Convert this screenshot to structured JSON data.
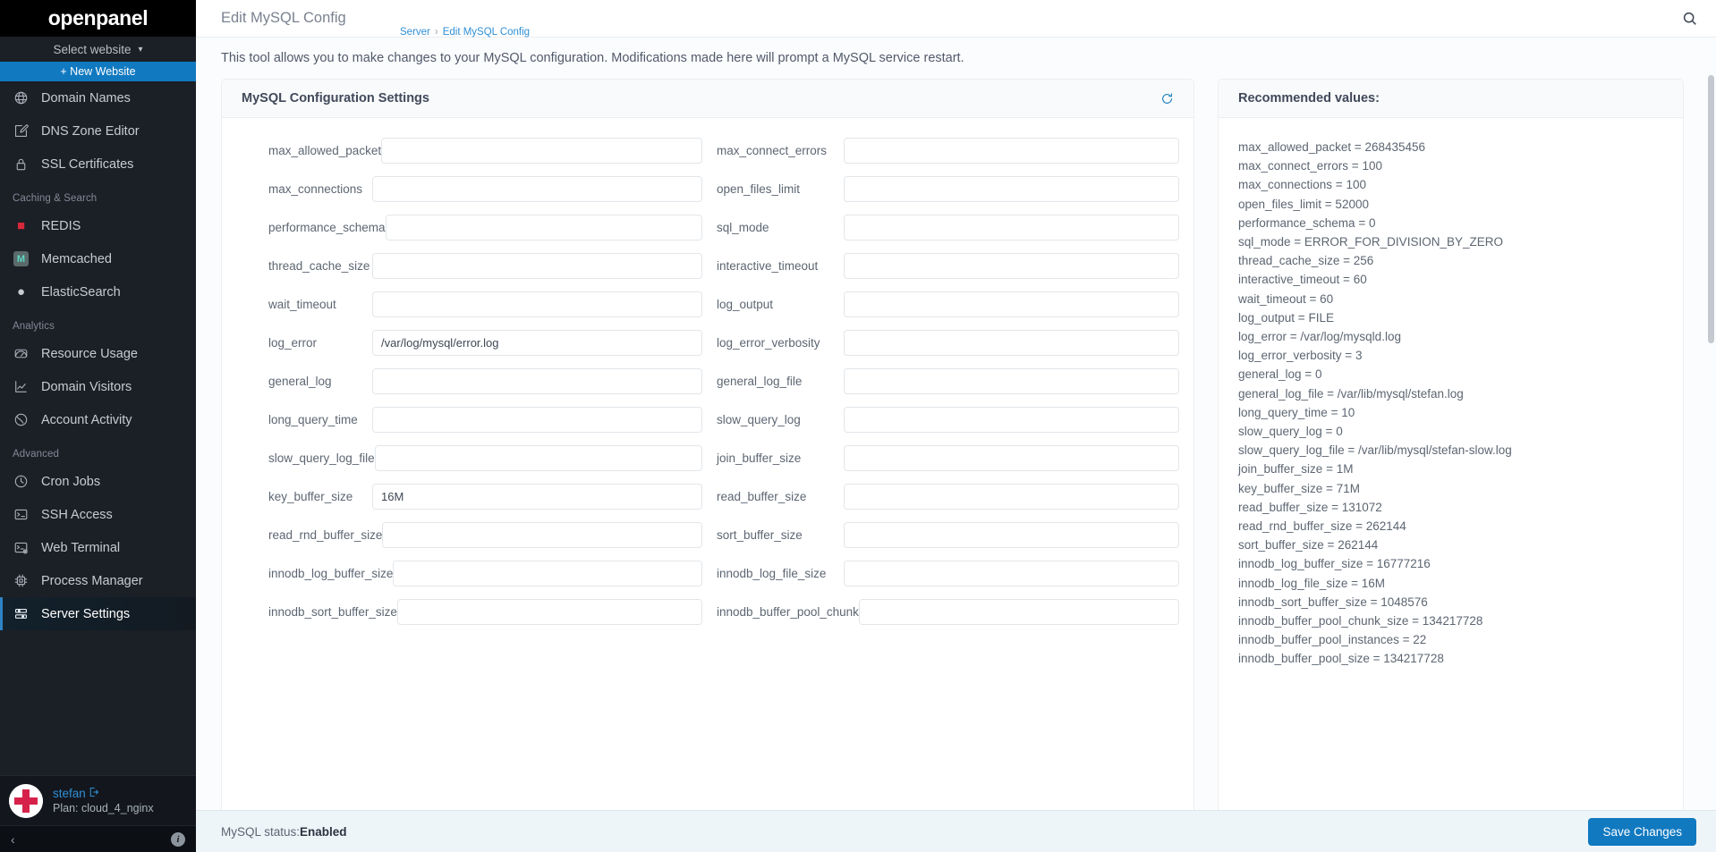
{
  "brand": {
    "name": "openpanel"
  },
  "sidebar": {
    "site_select": {
      "label": "Select website",
      "icon": "chevron-down-icon"
    },
    "new_website": {
      "label": "+ New Website"
    },
    "groups": [
      {
        "title": null,
        "items": [
          {
            "label": "Domain Names",
            "icon": "globe-icon",
            "active": false
          },
          {
            "label": "DNS Zone Editor",
            "icon": "edit-square-icon",
            "active": false
          },
          {
            "label": "SSL Certificates",
            "icon": "lock-icon",
            "active": false
          }
        ]
      },
      {
        "title": "Caching & Search",
        "items": [
          {
            "label": "REDIS",
            "icon": "redis-logo-icon",
            "active": false
          },
          {
            "label": "Memcached",
            "icon": "memcached-logo-icon",
            "active": false
          },
          {
            "label": "ElasticSearch",
            "icon": "elasticsearch-logo-icon",
            "active": false
          }
        ]
      },
      {
        "title": "Analytics",
        "items": [
          {
            "label": "Resource Usage",
            "icon": "gauge-icon",
            "active": false
          },
          {
            "label": "Domain Visitors",
            "icon": "line-chart-icon",
            "active": false
          },
          {
            "label": "Account Activity",
            "icon": "globe-activity-icon",
            "active": false
          }
        ]
      },
      {
        "title": "Advanced",
        "items": [
          {
            "label": "Cron Jobs",
            "icon": "clock-icon",
            "active": false
          },
          {
            "label": "SSH Access",
            "icon": "terminal-icon",
            "active": false
          },
          {
            "label": "Web Terminal",
            "icon": "web-terminal-icon",
            "active": false
          },
          {
            "label": "Process Manager",
            "icon": "cpu-icon",
            "active": false
          },
          {
            "label": "Server Settings",
            "icon": "server-settings-icon",
            "active": true
          }
        ]
      }
    ],
    "user": {
      "name": "stefan",
      "logout_icon": "logout-icon",
      "plan": "Plan: cloud_4_nginx",
      "avatar": "red-cross-avatar"
    },
    "footer": {
      "collapse_icon": "chevron-left-icon",
      "info_icon": "info-icon"
    }
  },
  "header": {
    "title": "Edit MySQL Config",
    "search_icon": "search-icon",
    "breadcrumb": [
      "Server",
      "Edit MySQL Config"
    ],
    "breadcrumb_separator": "›"
  },
  "intro": "This tool allows you to make changes to your MySQL configuration. Modifications made here will prompt a MySQL service restart.",
  "config_panel": {
    "title": "MySQL Configuration Settings",
    "refresh_icon": "refresh-icon",
    "rows": [
      {
        "left": {
          "label": "max_allowed_packet",
          "value": ""
        },
        "right": {
          "label": "max_connect_errors",
          "value": ""
        }
      },
      {
        "left": {
          "label": "max_connections",
          "value": ""
        },
        "right": {
          "label": "open_files_limit",
          "value": ""
        }
      },
      {
        "left": {
          "label": "performance_schema",
          "value": ""
        },
        "right": {
          "label": "sql_mode",
          "value": ""
        }
      },
      {
        "left": {
          "label": "thread_cache_size",
          "value": ""
        },
        "right": {
          "label": "interactive_timeout",
          "value": ""
        }
      },
      {
        "left": {
          "label": "wait_timeout",
          "value": ""
        },
        "right": {
          "label": "log_output",
          "value": ""
        }
      },
      {
        "left": {
          "label": "log_error",
          "value": "/var/log/mysql/error.log"
        },
        "right": {
          "label": "log_error_verbosity",
          "value": ""
        }
      },
      {
        "left": {
          "label": "general_log",
          "value": ""
        },
        "right": {
          "label": "general_log_file",
          "value": ""
        }
      },
      {
        "left": {
          "label": "long_query_time",
          "value": ""
        },
        "right": {
          "label": "slow_query_log",
          "value": ""
        }
      },
      {
        "left": {
          "label": "slow_query_log_file",
          "value": ""
        },
        "right": {
          "label": "join_buffer_size",
          "value": ""
        }
      },
      {
        "left": {
          "label": "key_buffer_size",
          "value": "16M"
        },
        "right": {
          "label": "read_buffer_size",
          "value": ""
        }
      },
      {
        "left": {
          "label": "read_rnd_buffer_size",
          "value": ""
        },
        "right": {
          "label": "sort_buffer_size",
          "value": ""
        }
      },
      {
        "left": {
          "label": "innodb_log_buffer_size",
          "value": ""
        },
        "right": {
          "label": "innodb_log_file_size",
          "value": ""
        }
      },
      {
        "left": {
          "label": "innodb_sort_buffer_size",
          "value": ""
        },
        "right": {
          "label": "innodb_buffer_pool_chunk",
          "value": ""
        }
      }
    ]
  },
  "recommended_panel": {
    "title": "Recommended values:",
    "lines": [
      "max_allowed_packet = 268435456",
      "max_connect_errors = 100",
      "max_connections = 100",
      "open_files_limit = 52000",
      "performance_schema = 0",
      "sql_mode = ERROR_FOR_DIVISION_BY_ZERO",
      "thread_cache_size = 256",
      "interactive_timeout = 60",
      "wait_timeout = 60",
      "log_output = FILE",
      "log_error = /var/log/mysqld.log",
      "log_error_verbosity = 3",
      "general_log = 0",
      "general_log_file = /var/lib/mysql/stefan.log",
      "long_query_time = 10",
      "slow_query_log = 0",
      "slow_query_log_file = /var/lib/mysql/stefan-slow.log",
      "join_buffer_size = 1M",
      "key_buffer_size = 71M",
      "read_buffer_size = 131072",
      "read_rnd_buffer_size = 262144",
      "sort_buffer_size = 262144",
      "innodb_log_buffer_size = 16777216",
      "innodb_log_file_size = 16M",
      "innodb_sort_buffer_size = 1048576",
      "innodb_buffer_pool_chunk_size = 134217728",
      "innodb_buffer_pool_instances = 22",
      "innodb_buffer_pool_size = 134217728"
    ]
  },
  "footer": {
    "status_label": "MySQL status:",
    "status_value": "Enabled",
    "save_label": "Save Changes"
  },
  "colors": {
    "accent": "#1179c0",
    "sidebar_bg": "#1b1f26",
    "brand_bg": "#000000",
    "link": "#2f8fd6",
    "footer_bg": "#eef5f9"
  }
}
